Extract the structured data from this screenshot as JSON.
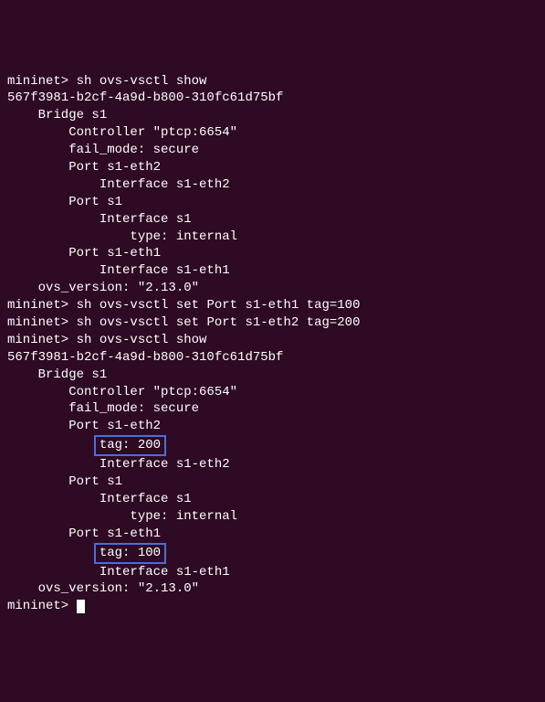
{
  "prompts": {
    "mininet": "mininet> ",
    "mininet_cursor": "mininet> "
  },
  "commands": {
    "show1": "sh ovs-vsctl show",
    "set1": "sh ovs-vsctl set Port s1-eth1 tag=100",
    "set2": "sh ovs-vsctl set Port s1-eth2 tag=200",
    "show2": "sh ovs-vsctl show"
  },
  "output1": {
    "uuid": "567f3981-b2cf-4a9d-b800-310fc61d75bf",
    "bridge": "    Bridge s1",
    "controller": "        Controller \"ptcp:6654\"",
    "fail_mode": "        fail_mode: secure",
    "port_eth2": "        Port s1-eth2",
    "iface_eth2": "            Interface s1-eth2",
    "port_s1": "        Port s1",
    "iface_s1": "            Interface s1",
    "type_internal": "                type: internal",
    "port_eth1": "        Port s1-eth1",
    "iface_eth1": "            Interface s1-eth1",
    "ovs_version": "    ovs_version: \"2.13.0\""
  },
  "output2": {
    "uuid": "567f3981-b2cf-4a9d-b800-310fc61d75bf",
    "bridge": "    Bridge s1",
    "controller": "        Controller \"ptcp:6654\"",
    "fail_mode": "        fail_mode: secure",
    "port_eth2": "        Port s1-eth2",
    "tag_200_indent": "            ",
    "tag_200": "tag: 200",
    "iface_eth2": "            Interface s1-eth2",
    "port_s1": "        Port s1",
    "iface_s1": "            Interface s1",
    "type_internal": "                type: internal",
    "port_eth1": "        Port s1-eth1",
    "tag_100_indent": "            ",
    "tag_100": "tag: 100",
    "iface_eth1": "            Interface s1-eth1",
    "ovs_version": "    ovs_version: \"2.13.0\""
  }
}
